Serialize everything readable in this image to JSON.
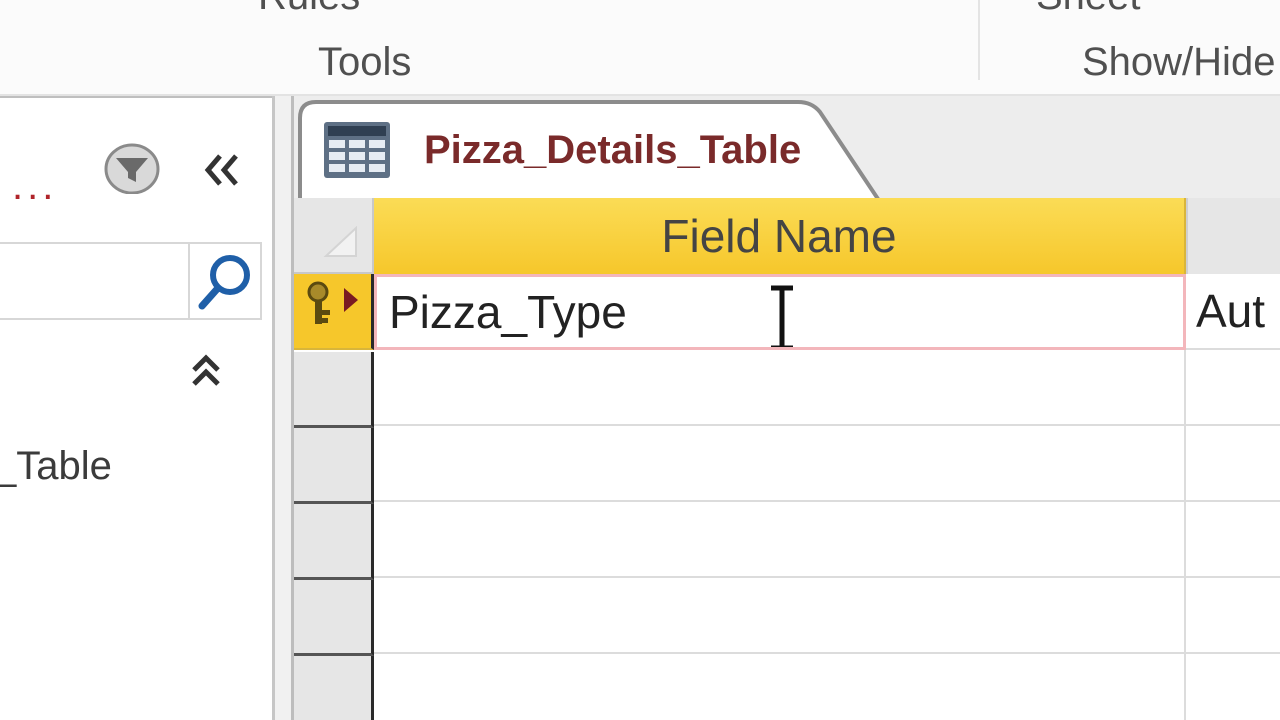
{
  "ribbon": {
    "groups": [
      {
        "label": "Tools",
        "top_label": "Rules"
      },
      {
        "label": "Show/Hide",
        "top_label": "Sheet"
      }
    ]
  },
  "nav_pane": {
    "header_dots": "...",
    "search": {
      "value": "",
      "placeholder": ""
    },
    "item_label": "_Table"
  },
  "document": {
    "tab_title": "Pizza_Details_Table",
    "columns": [
      "Field Name",
      ""
    ],
    "rows": [
      {
        "field_name": "Pizza_Type",
        "data_type": "Aut",
        "primary_key": true,
        "current": true
      },
      {
        "field_name": "",
        "data_type": ""
      },
      {
        "field_name": "",
        "data_type": ""
      },
      {
        "field_name": "",
        "data_type": ""
      },
      {
        "field_name": "",
        "data_type": ""
      }
    ]
  },
  "colors": {
    "header_accent": "#f6c72b",
    "tab_title": "#7a2a2a",
    "edit_border": "#f3b6bb",
    "nav_dots": "#b0242a"
  },
  "icons": {
    "nav_filter": "filter-icon",
    "nav_collapse": "double-chevron-left-icon",
    "search": "search-icon",
    "group_collapse": "double-chevron-up-icon",
    "table": "table-icon",
    "primary_key": "key-icon",
    "current_record": "record-pointer-icon",
    "cursor": "text-cursor-icon"
  }
}
